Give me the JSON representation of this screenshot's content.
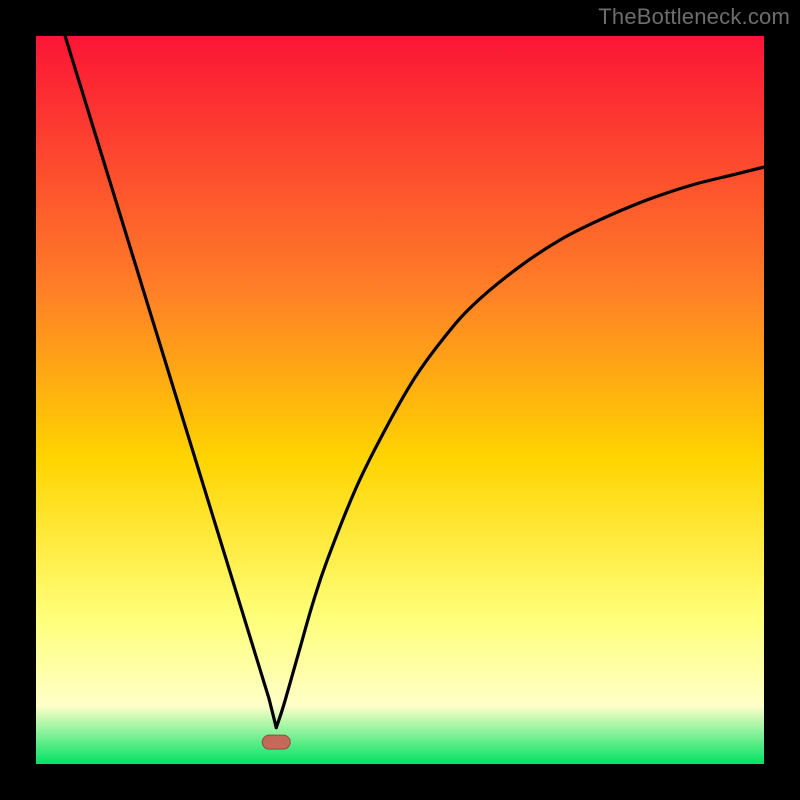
{
  "attribution": {
    "text": "TheBottleneck.com"
  },
  "colors": {
    "frame": "#000000",
    "gradient_top": "#fb1536",
    "gradient_mid_upper": "#ff7f27",
    "gradient_mid": "#ffd400",
    "gradient_mid_lower": "#ffff7a",
    "gradient_lower": "#ffffc8",
    "gradient_bottom": "#00e264",
    "curve": "#000000",
    "marker_fill": "#c46a5b",
    "marker_stroke": "#9a4a3e"
  },
  "chart_data": {
    "type": "line",
    "title": "",
    "xlabel": "",
    "ylabel": "",
    "xlim": [
      0,
      100
    ],
    "ylim": [
      0,
      100
    ],
    "grid": false,
    "legend": false,
    "annotations": [],
    "series": [
      {
        "name": "left-branch",
        "x": [
          4,
          6,
          8,
          10,
          12,
          14,
          16,
          18,
          20,
          22,
          24,
          26,
          28,
          30,
          32,
          33
        ],
        "values": [
          100,
          93.5,
          87,
          80.5,
          74,
          67.5,
          61,
          54.5,
          48,
          41.5,
          35,
          28.5,
          22,
          15.5,
          9,
          5
        ]
      },
      {
        "name": "right-branch",
        "x": [
          33,
          34,
          36,
          38,
          40,
          44,
          48,
          52,
          56,
          60,
          66,
          72,
          78,
          84,
          90,
          96,
          100
        ],
        "values": [
          5,
          8,
          15,
          22,
          28,
          38,
          46,
          53,
          58.5,
          63,
          68,
          72,
          75,
          77.5,
          79.5,
          81,
          82
        ]
      }
    ],
    "marker": {
      "x": 33,
      "y": 3
    }
  }
}
